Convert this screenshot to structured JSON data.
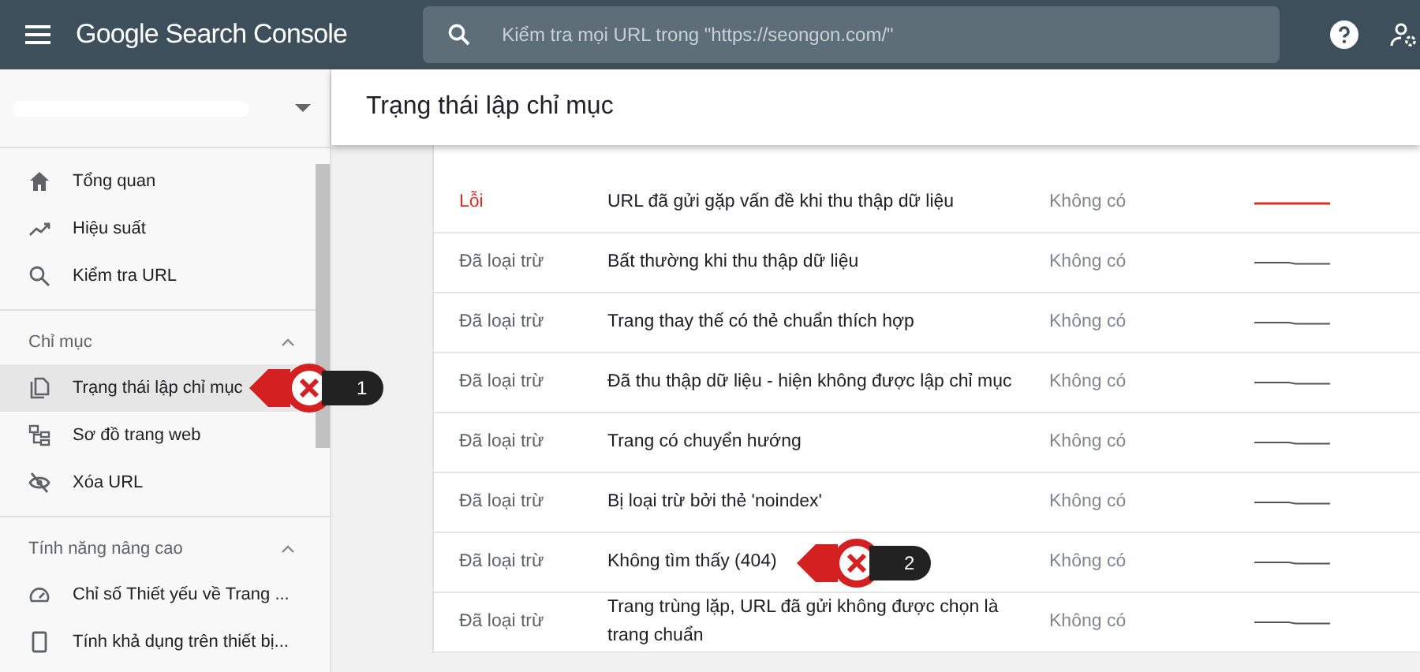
{
  "topbar": {
    "product": "Google Search Console",
    "search": {
      "placeholder": "Kiểm tra mọi URL trong \"https://seongon.com/\""
    }
  },
  "sidebar": {
    "sections": [
      {
        "items": [
          {
            "label": "Tổng quan",
            "selected": false
          },
          {
            "label": "Hiệu suất",
            "selected": false
          },
          {
            "label": "Kiểm tra URL",
            "selected": false
          }
        ]
      },
      {
        "title": "Chỉ mục",
        "expanded": true,
        "items": [
          {
            "label": "Trạng thái lập chỉ mục",
            "selected": true,
            "callout": "1"
          },
          {
            "label": "Sơ đồ trang web",
            "selected": false
          },
          {
            "label": "Xóa URL",
            "selected": false
          }
        ]
      },
      {
        "title": "Tính năng nâng cao",
        "expanded": true,
        "items": [
          {
            "label": "Chỉ số Thiết yếu về Trang ...",
            "selected": false
          },
          {
            "label": "Tính khả dụng trên thiết bị...",
            "selected": false
          }
        ]
      }
    ]
  },
  "main": {
    "title": "Trạng thái lập chỉ mục",
    "rows": [
      {
        "kind": "error",
        "status": "Lỗi",
        "reason": "URL đã gửi gặp vấn đề khi thu thập dữ liệu",
        "validation": "Không có"
      },
      {
        "kind": "excluded",
        "status": "Đã loại trừ",
        "reason": "Bất thường khi thu thập dữ liệu",
        "validation": "Không có"
      },
      {
        "kind": "excluded",
        "status": "Đã loại trừ",
        "reason": "Trang thay thế có thẻ chuẩn thích hợp",
        "validation": "Không có"
      },
      {
        "kind": "excluded",
        "status": "Đã loại trừ",
        "reason": "Đã thu thập dữ liệu - hiện không được lập chỉ mục",
        "validation": "Không có"
      },
      {
        "kind": "excluded",
        "status": "Đã loại trừ",
        "reason": "Trang có chuyển hướng",
        "validation": "Không có"
      },
      {
        "kind": "excluded",
        "status": "Đã loại trừ",
        "reason": "Bị loại trừ bởi thẻ 'noindex'",
        "validation": "Không có"
      },
      {
        "kind": "excluded",
        "status": "Đã loại trừ",
        "reason": "Không tìm thấy (404)",
        "validation": "Không có",
        "callout": "2"
      },
      {
        "kind": "excluded",
        "status": "Đã loại trừ",
        "reason": "Trang trùng lặp, URL đã gửi không được chọn là trang chuẩn",
        "validation": "Không có"
      }
    ]
  }
}
